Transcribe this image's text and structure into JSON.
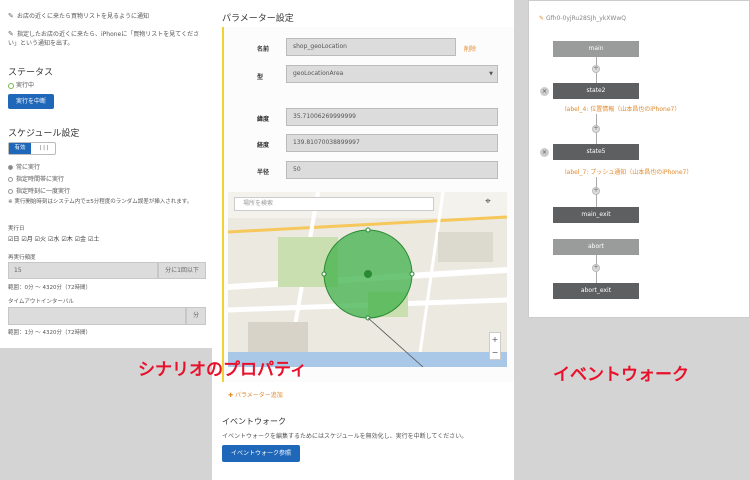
{
  "left": {
    "notes": [
      "お店の近くに来たら買物リストを見るように通知",
      "指定したお店の近くに来たら、iPhoneに「買物リストを見てください」という通知を出す。"
    ],
    "status_heading": "ステータス",
    "status_text": "実行中",
    "stop_button": "実行を中断",
    "schedule_heading": "スケジュール設定",
    "toggle_on": "有効",
    "toggle_off": "| | |",
    "radios": [
      "常に実行",
      "指定時間帯に実行",
      "指定時刻に一度実行"
    ],
    "random_note": "※ 実行開始時刻はシステム内で±5分程度のランダム誤差が挿入されます。",
    "run_days_label": "実行日",
    "days": [
      "日",
      "月",
      "火",
      "水",
      "木",
      "金",
      "土"
    ],
    "interval_label": "再実行頻度",
    "interval_value": "15",
    "interval_unit": "分に1回以下",
    "interval_range": "範囲：0分 ～ 4320分（72時間）",
    "timeout_label": "タイムアウトインターバル",
    "timeout_unit": "分",
    "timeout_range": "範囲：1分 ～ 4320分（72時間）"
  },
  "mid": {
    "title": "パラメーター設定",
    "name_label": "名前",
    "name_value": "shop_geoLocation",
    "delete_link": "削除",
    "type_label": "型",
    "type_value": "geoLocationArea",
    "lat_label": "緯度",
    "lat_value": "35.71006269999999",
    "lng_label": "経度",
    "lng_value": "139.81070038899997",
    "radius_label": "半径",
    "radius_value": "50",
    "map_search_placeholder": "場所を検索",
    "add_param": "パラメーター追加",
    "eventwalk_heading": "イベントウォーク",
    "eventwalk_desc": "イベントウォークを編集するためにはスケジュールを無効化し、実行を中断してください。",
    "eventwalk_button": "イベントウォーク参照"
  },
  "right": {
    "flow_id": "Gfh0-0yjRu28SJh_ykXWwQ",
    "nodes": [
      "main",
      "state2",
      "state5",
      "main_exit",
      "abort",
      "abort_exit"
    ],
    "labels": [
      "label_4: 位置情報（山本昌也のiPhone7）",
      "label_7: プッシュ通知（山本昌也のiPhone7）"
    ]
  },
  "overlays": {
    "left_caption": "シナリオのプロパティ",
    "right_caption": "イベントウォーク"
  },
  "colors": {
    "primary": "#1f67b9",
    "accent_yellow": "#f0d230",
    "node_gray": "#9a9b9b",
    "node_dark": "#5d5f61",
    "label_orange": "#e08a2c",
    "caption_red": "#e8102a"
  }
}
